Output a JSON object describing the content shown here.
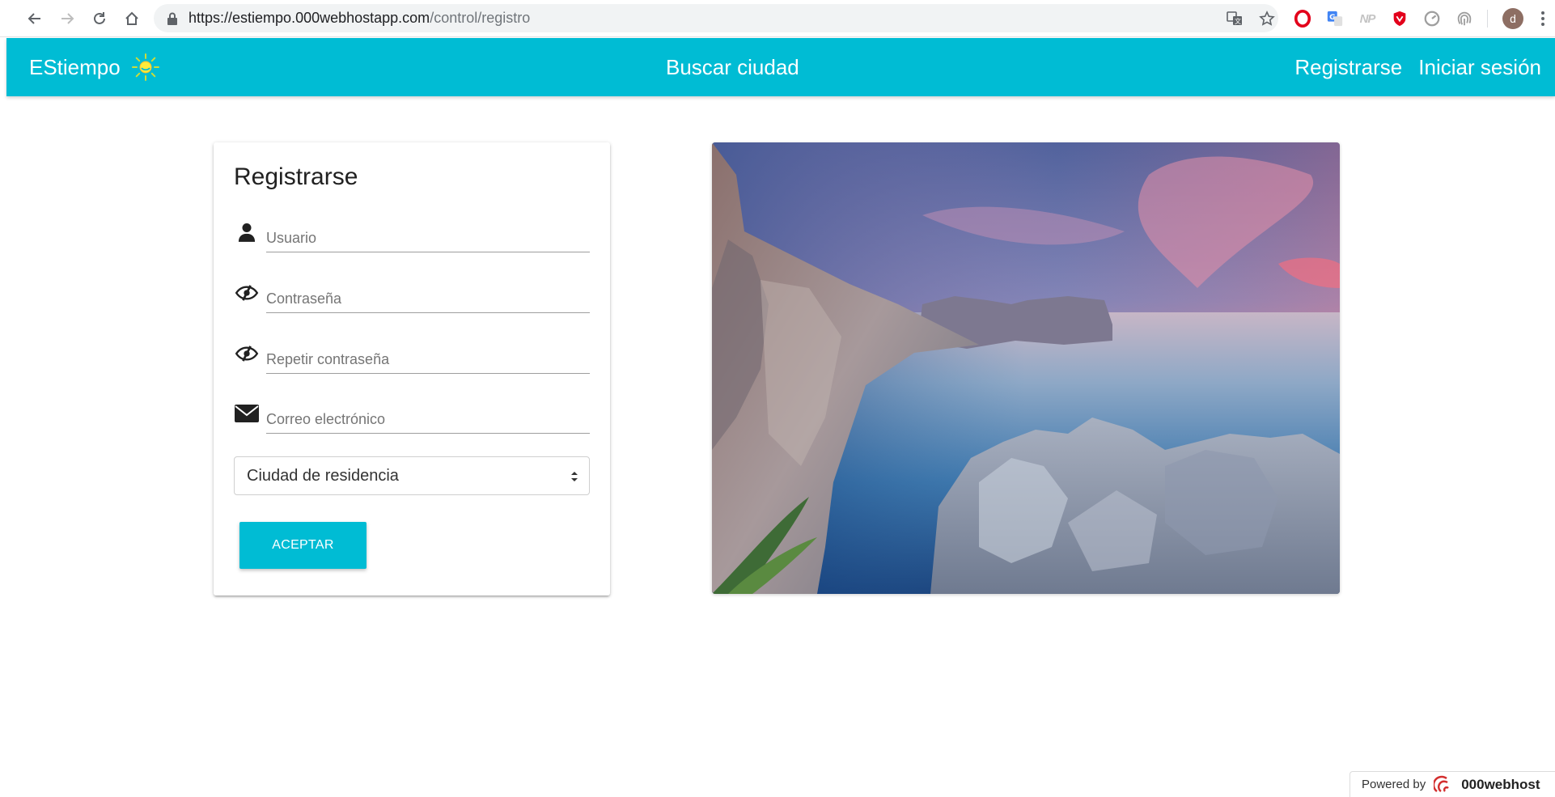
{
  "browser": {
    "url_host": "https://estiempo.000webhostapp.com",
    "url_path": "/control/registro",
    "avatar_letter": "d",
    "extensions": [
      "opera-icon",
      "google-translate-icon",
      "np-icon",
      "shield-icon",
      "speed-dial-icon",
      "fingerprint-icon"
    ],
    "np_label": "NP"
  },
  "navbar": {
    "brand": "EStiempo",
    "search_link": "Buscar ciudad",
    "register_link": "Registrarse",
    "login_link": "Iniciar sesión",
    "color": "#00bcd4"
  },
  "form": {
    "title": "Registrarse",
    "fields": [
      {
        "icon": "user-icon",
        "placeholder": "Usuario"
      },
      {
        "icon": "eye-slash-icon",
        "placeholder": "Contraseña"
      },
      {
        "icon": "eye-slash-icon",
        "placeholder": "Repetir contraseña"
      },
      {
        "icon": "envelope-icon",
        "placeholder": "Correo electrónico"
      }
    ],
    "city_select": "Ciudad de residencia",
    "submit": "ACEPTAR"
  },
  "footer": {
    "powered_by": "Powered by",
    "host_brand": "000webhost"
  }
}
